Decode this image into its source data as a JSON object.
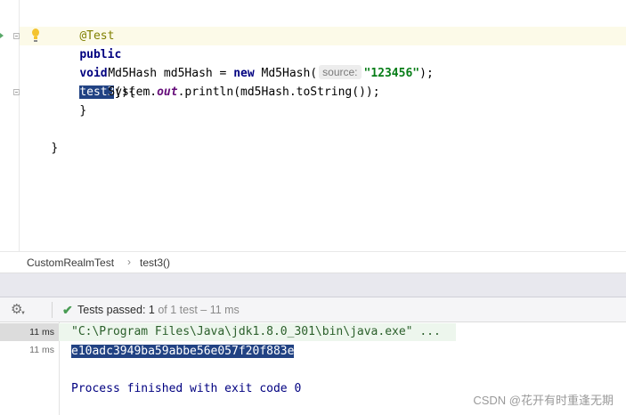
{
  "editor": {
    "lines": [
      {
        "annotation": "@Test"
      },
      {
        "kw_public": "public",
        "kw_void": "void",
        "method_name": "test3",
        "rest": "(){"
      },
      {
        "type1": "Md5Hash",
        "var": " md5Hash = ",
        "kw_new": "new",
        "ctor": " Md5Hash(",
        "hint": "source:",
        "str": "\"123456\"",
        "end": ");"
      },
      {
        "sys": "System.",
        "field": "out",
        "call": ".println(md5Hash.toString());"
      },
      {
        "close": "}"
      },
      {
        "close": "}"
      }
    ]
  },
  "breadcrumb": {
    "class_name": "CustomRealmTest",
    "separator": "›",
    "method": "test3()"
  },
  "run_toolbar": {
    "gear": "⚙",
    "check": "✔",
    "status_label": "Tests passed: ",
    "passed_count": "1",
    "total_text": " of 1 test – 11 ms"
  },
  "console": {
    "times": [
      "11 ms",
      "11 ms"
    ],
    "lines": [
      "\"C:\\Program Files\\Java\\jdk1.8.0_301\\bin\\java.exe\" ...",
      "e10adc3949ba59abbe56e057f20f883e",
      "",
      "Process finished with exit code 0"
    ]
  },
  "watermark": "CSDN @花开有时重逢无期",
  "colors": {
    "keyword": "#000080",
    "annotation": "#808000",
    "string": "#067d17",
    "selection": "#214283",
    "passed": "#499c54"
  }
}
